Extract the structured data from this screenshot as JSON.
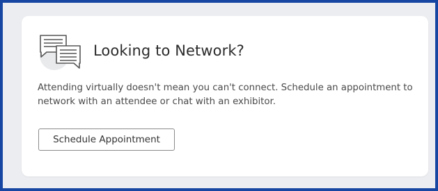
{
  "card": {
    "icon": "chat-bubbles-icon",
    "title": "Looking to Network?",
    "description": "Attending virtually doesn't mean you can't connect. Schedule an appointment to network with an attendee or chat with an exhibitor.",
    "button_label": "Schedule Appointment"
  },
  "colors": {
    "frame_border": "#1746a2",
    "page_background": "#ecedf0",
    "card_background": "#ffffff",
    "button_border": "#8a8a8a"
  }
}
